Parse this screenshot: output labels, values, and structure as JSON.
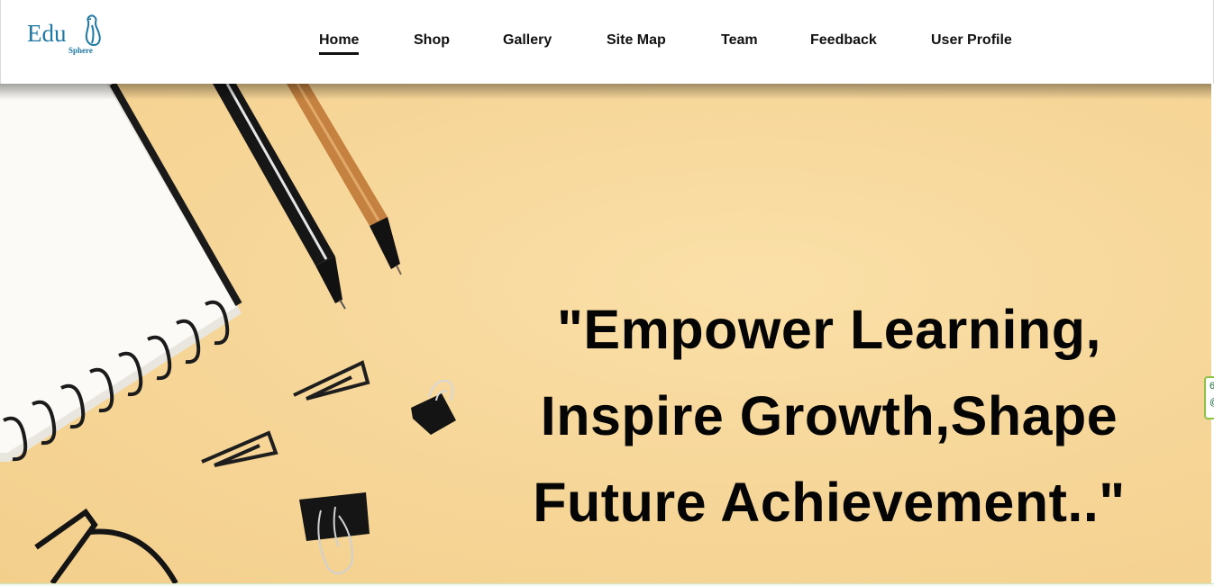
{
  "logo": {
    "text_main": "Edu",
    "text_sub": "Sphere",
    "icon": "bird-logo-icon",
    "color": "#1d78a4"
  },
  "nav": {
    "items": [
      {
        "label": "Home",
        "active": true
      },
      {
        "label": "Shop"
      },
      {
        "label": "Gallery"
      },
      {
        "label": "Site Map"
      },
      {
        "label": "Team"
      },
      {
        "label": "Feedback"
      },
      {
        "label": "User Profile"
      }
    ]
  },
  "hero": {
    "quote_lines": [
      "\"Empower Learning,",
      "Inspire Growth,Shape",
      "Future Achievement..\""
    ],
    "background_color": "#f7d79a",
    "image_subject": "notebook-pens-clips-illustration"
  },
  "side_widget": {
    "line1": "6",
    "line2": "@"
  }
}
